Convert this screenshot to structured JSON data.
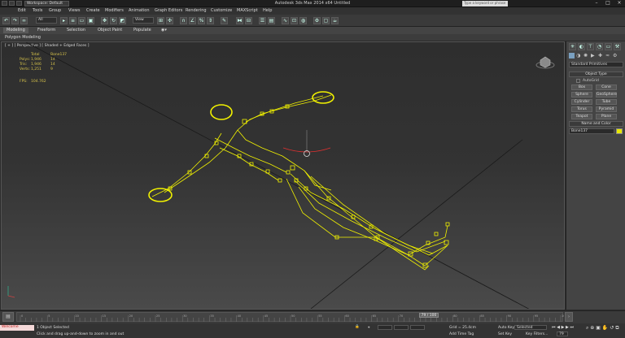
{
  "app": {
    "title": "Autodesk 3ds Max  2014 x64    Untitled",
    "workspace": "Workspace: Default",
    "search_placeholder": "Type a keyword or phrase"
  },
  "menus": [
    "Edit",
    "Tools",
    "Group",
    "Views",
    "Create",
    "Modifiers",
    "Animation",
    "Graph Editors",
    "Rendering",
    "Customize",
    "MAXScript",
    "Help"
  ],
  "toolbar": {
    "selection_filter": "All",
    "ref_coord": "View"
  },
  "ribbon": {
    "tabs": [
      "Modeling",
      "Freeform",
      "Selection",
      "Object Paint",
      "Populate"
    ],
    "sub": "Polygon Modeling"
  },
  "viewport": {
    "label": "[ + ] [ Perspective ] [ Shaded + Edged Faces ]",
    "stats": {
      "header_total": "Total",
      "header_obj": "Bone137",
      "rows": [
        {
          "k": "Polys:",
          "v1": "1,946",
          "v2": "14"
        },
        {
          "k": "Tris:",
          "v1": "1,946",
          "v2": "14"
        },
        {
          "k": "Verts:",
          "v1": "1,251",
          "v2": "9"
        }
      ],
      "fps_label": "FPS:",
      "fps_value": "104.762"
    }
  },
  "command_panel": {
    "dropdown": "Standard Primitives",
    "object_type": "Object Type",
    "autogrid": "AutoGrid",
    "buttons": [
      "Box",
      "Cone",
      "Sphere",
      "GeoSphere",
      "Cylinder",
      "Tube",
      "Torus",
      "Pyramid",
      "Teapot",
      "Plane"
    ],
    "name_color": "Name and Color",
    "name_value": "Bone137",
    "swatch": "#e8e800"
  },
  "timeline": {
    "frame": "79 / 100",
    "ticks": [
      "0",
      "5",
      "10",
      "15",
      "20",
      "25",
      "30",
      "35",
      "40",
      "45",
      "50",
      "55",
      "60",
      "65",
      "70",
      "75",
      "80",
      "85",
      "90",
      "95",
      "100"
    ]
  },
  "status": {
    "script_label": "Welcome",
    "selected": "1 Object Selected",
    "prompt": "Click and drag up-and-down to zoom in and out",
    "grid": "Grid = 25.4cm",
    "autokey": "Auto Key",
    "autokey_value": "Selected",
    "setkey": "Set Key",
    "keyfilters": "Key Filters...",
    "addtimetag": "Add Time Tag",
    "frame_field": "79"
  },
  "colors": {
    "bone": "#f2f200",
    "accent": "#e03030"
  }
}
